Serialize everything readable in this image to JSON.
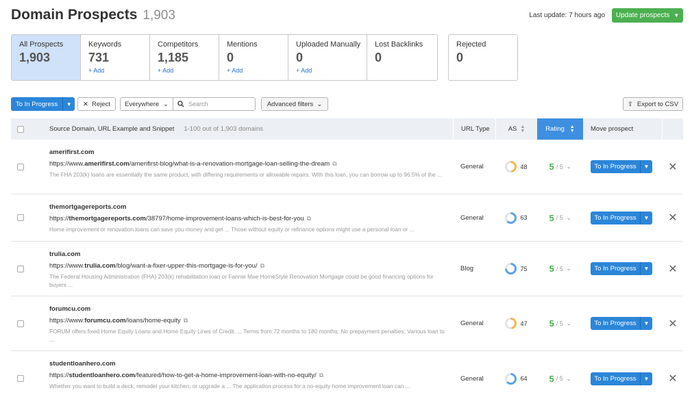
{
  "header": {
    "title": "Domain Prospects",
    "count": "1,903",
    "last_update": "Last update: 7 hours ago",
    "update_button": "Update prospects"
  },
  "tabs": [
    {
      "label": "All Prospects",
      "count": "1,903",
      "add": ""
    },
    {
      "label": "Keywords",
      "count": "731",
      "add": "+ Add"
    },
    {
      "label": "Competitors",
      "count": "1,185",
      "add": "+ Add"
    },
    {
      "label": "Mentions",
      "count": "0",
      "add": "+ Add"
    },
    {
      "label": "Uploaded Manually",
      "count": "0",
      "add": "+ Add"
    },
    {
      "label": "Lost Backlinks",
      "count": "0",
      "add": ""
    }
  ],
  "rejected": {
    "label": "Rejected",
    "count": "0"
  },
  "toolbar": {
    "to_in_progress": "To In Progress",
    "reject": "Reject",
    "where": "Everywhere",
    "search_placeholder": "Search",
    "advanced_filters": "Advanced filters",
    "export": "Export to CSV"
  },
  "table": {
    "col_source": "Source Domain, URL Example and Snippet",
    "range": "1-100 out of 1,903 domains",
    "col_url_type": "URL Type",
    "col_as": "AS",
    "col_rating": "Rating",
    "col_move": "Move prospect",
    "rows": [
      {
        "domain": "amerifirst.com",
        "url_pre": "https://www.",
        "url_bold": "amerifirst.com",
        "url_post": "/amerifirst-blog/what-is-a-renovation-mortgage-loan-selling-the-dream",
        "snippet": "The FHA 203(k) loans are essentially the same product, with differing requirements or allowable repairs. With this loan, you can borrow up to 96.5% of the ...",
        "type": "General",
        "as": "48",
        "as_color": "#f5b547",
        "rating": "5",
        "rating_out": "/ 5",
        "move": "To In Progress"
      },
      {
        "domain": "themortgagereports.com",
        "url_pre": "https://",
        "url_bold": "themortgagereports.com",
        "url_post": "/38797/home-improvement-loans-which-is-best-for-you",
        "snippet": "Home improvement or renovation loans can save you money and get ... Those without equity or refinance options might use a personal loan or ...",
        "type": "General",
        "as": "63",
        "as_color": "#5aa2e6",
        "rating": "5",
        "rating_out": "/ 5",
        "move": "To In Progress"
      },
      {
        "domain": "trulia.com",
        "url_pre": "https://www.",
        "url_bold": "trulia.com",
        "url_post": "/blog/want-a-fixer-upper-this-mortgage-is-for-you/",
        "snippet": "The Federal Housing Administration (FHA) 203(k) rehabilitation loan or Fannie Mae HomeStyle Renovation Mortgage could be good financing options for buyers ...",
        "type": "Blog",
        "as": "75",
        "as_color": "#5aa2e6",
        "rating": "5",
        "rating_out": "/ 5",
        "move": "To In Progress"
      },
      {
        "domain": "forumcu.com",
        "url_pre": "https://www.",
        "url_bold": "forumcu.com",
        "url_post": "/loans/home-equity",
        "snippet": "FORUM offers fixed Home Equity Loans and Home Equity Lines of Credit. ... Terms from 72 months to 180 months; No prepayment penalties; Various loan to ...",
        "type": "General",
        "as": "47",
        "as_color": "#f5b547",
        "rating": "5",
        "rating_out": "/ 5",
        "move": "To In Progress"
      },
      {
        "domain": "studentloanhero.com",
        "url_pre": "https://",
        "url_bold": "studentloanhero.com",
        "url_post": "/featured/how-to-get-a-home-improvement-loan-with-no-equity/",
        "snippet": "Whether you want to build a deck, remodel your kitchen, or upgrade a ... The application process for a no-equity home improvement loan can ...",
        "type": "General",
        "as": "64",
        "as_color": "#5aa2e6",
        "rating": "5",
        "rating_out": "/ 5",
        "move": "To In Progress"
      }
    ]
  }
}
